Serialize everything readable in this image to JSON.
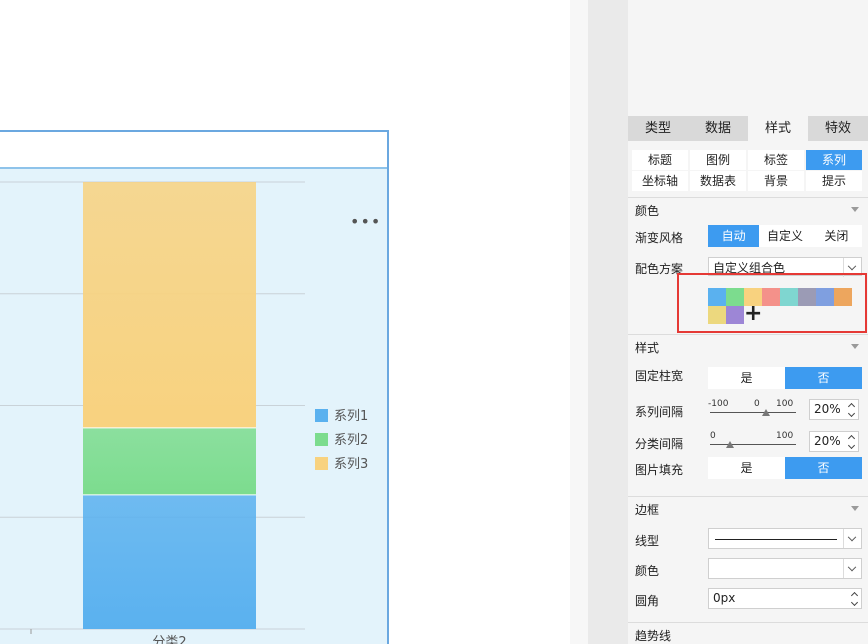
{
  "chart_data": {
    "type": "bar",
    "stacked": true,
    "categories": [
      "分类2"
    ],
    "series": [
      {
        "name": "系列1",
        "values": [
          30
        ],
        "color": "#5ab1ef"
      },
      {
        "name": "系列2",
        "values": [
          15
        ],
        "color": "#7cdc8e"
      },
      {
        "name": "系列3",
        "values": [
          55
        ],
        "color": "#f8d27f"
      }
    ],
    "ylim": [
      0,
      100
    ],
    "grid": true,
    "legend_placement": "right"
  },
  "chart_ui": {
    "more_icon": "more-dots-icon",
    "legend": [
      "系列1",
      "系列2",
      "系列3"
    ],
    "category_label": "分类2"
  },
  "panel": {
    "tabs": [
      "类型",
      "数据",
      "样式",
      "特效"
    ],
    "active_tab": "样式",
    "subtabs": [
      "标题",
      "图例",
      "标签",
      "系列",
      "坐标轴",
      "数据表",
      "背景",
      "提示"
    ],
    "active_subtab": "系列",
    "color_section": {
      "title": "颜色",
      "gradient_label": "渐变风格",
      "gradient_options": [
        "自动",
        "自定义",
        "关闭"
      ],
      "gradient_selected": "自动",
      "scheme_label": "配色方案",
      "scheme_value": "自定义组合色",
      "swatches": [
        "#5ab1ef",
        "#7cdc8e",
        "#f8d27f",
        "#f4918a",
        "#7fd6d0",
        "#9b9bb5",
        "#7f9fe0",
        "#eda65e",
        "#ecd87e",
        "#9d86d6"
      ],
      "add_icon": "plus-icon"
    },
    "style_section": {
      "title": "样式",
      "fixed_width_label": "固定柱宽",
      "fixed_width_options": [
        "是",
        "否"
      ],
      "fixed_width_selected": "否",
      "series_gap_label": "系列间隔",
      "series_gap_scale": [
        "-100",
        "0",
        "100"
      ],
      "series_gap_value": "20%",
      "category_gap_label": "分类间隔",
      "category_gap_scale": [
        "0",
        "100"
      ],
      "category_gap_value": "20%",
      "image_fill_label": "图片填充",
      "image_fill_options": [
        "是",
        "否"
      ],
      "image_fill_selected": "否"
    },
    "border_section": {
      "title": "边框",
      "line_label": "线型",
      "color_label": "颜色",
      "radius_label": "圆角",
      "radius_value": "0px"
    },
    "trend_section": {
      "title": "趋势线"
    }
  }
}
